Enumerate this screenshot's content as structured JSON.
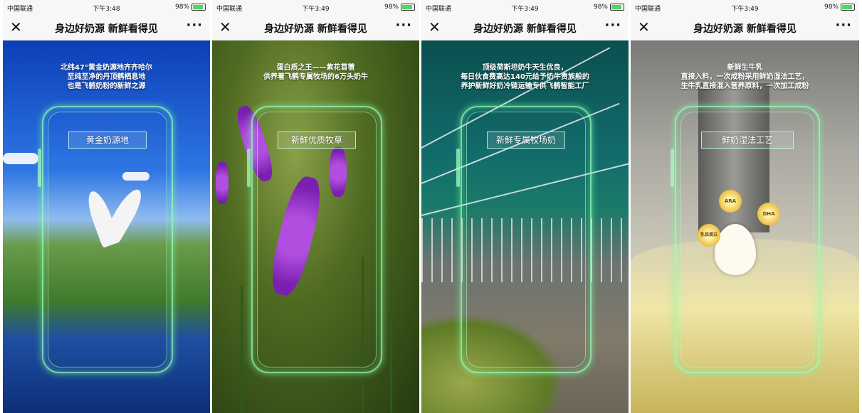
{
  "status_bar": {
    "carrier": "中国联通",
    "battery": "98%",
    "battery_level": 0.98
  },
  "navbar": {
    "close_glyph": "✕",
    "title": "身边好奶源 新鲜看得见",
    "more_glyph": "···"
  },
  "screens": [
    {
      "time": "下午3:48",
      "caption": [
        "北纬47°黄金奶源地齐齐哈尔",
        "至纯至净的丹顶鹤栖息地",
        "也是飞鹤奶粉的新鲜之源"
      ],
      "label": "黄金奶源地"
    },
    {
      "time": "下午3:49",
      "caption": [
        "蛋白质之王——紫花苜蓿",
        "供养着飞鹤专属牧场的6万头奶牛"
      ],
      "label": "新鲜优质牧草"
    },
    {
      "time": "下午3:49",
      "caption": [
        "顶级荷斯坦奶牛天生优良，",
        "每日伙食费高达140元给予奶牛贵族般的",
        "养护新鲜好奶冷链运输专供飞鹤智能工厂"
      ],
      "label": "新鲜专属牧场奶"
    },
    {
      "time": "下午3:49",
      "caption": [
        "新鲜生牛乳",
        "直接入料，一次成粉采用鲜奶湿法工艺，",
        "生牛乳直接混入营养原料，一次加工成粉"
      ],
      "label": "鲜奶湿法工艺",
      "bubbles": [
        "ARA",
        "DHA",
        "乳铁蛋白"
      ]
    }
  ],
  "colors": {
    "frame_glow": "#96ffbe",
    "battery_green": "#4cd964"
  }
}
